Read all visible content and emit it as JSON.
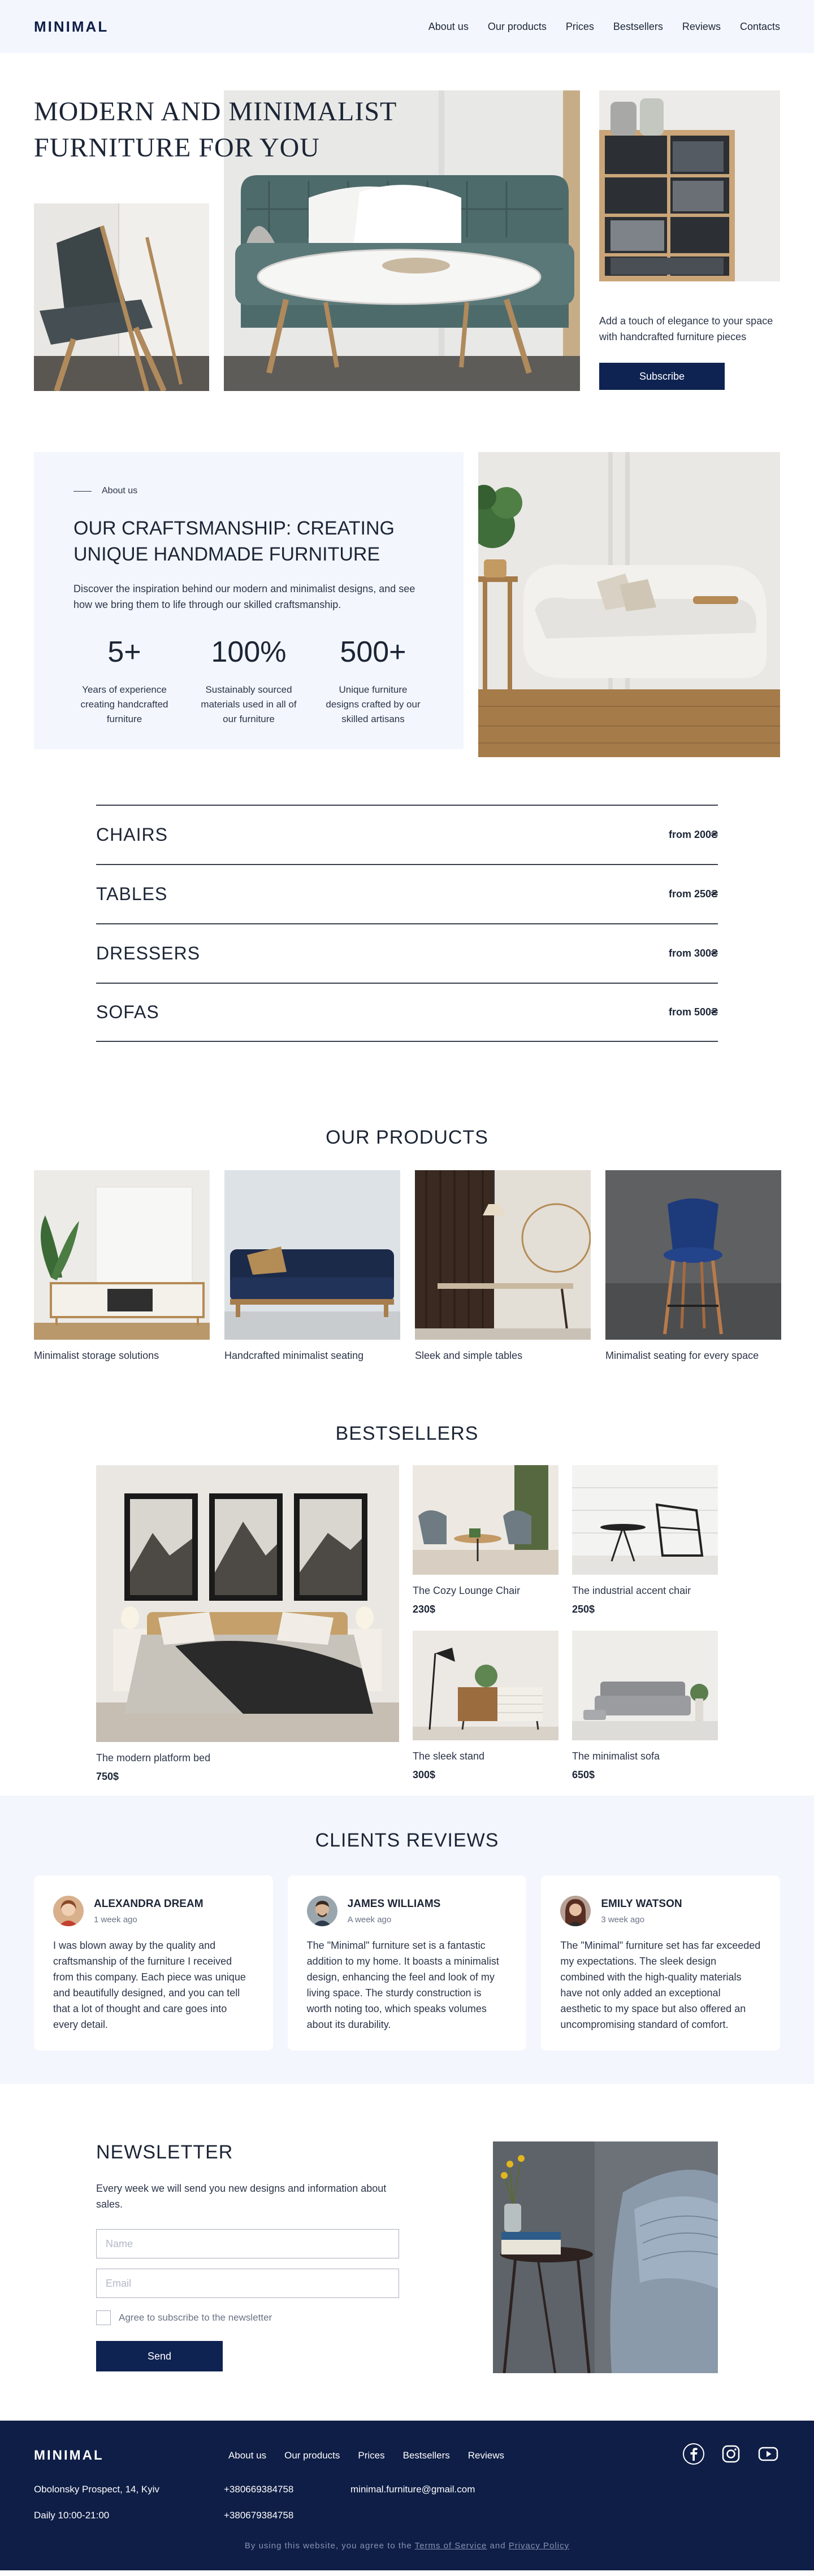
{
  "header": {
    "logo": "MINIMAL",
    "nav": [
      "About us",
      "Our products",
      "Prices",
      "Bestsellers",
      "Reviews",
      "Contacts"
    ]
  },
  "hero": {
    "title_line1": "MODERN AND MINIMALIST",
    "title_line2": "FURNITURE FOR YOU",
    "text": "Add a touch of elegance to your space with handcrafted furniture pieces",
    "button": "Subscribe"
  },
  "about": {
    "kicker": "About us",
    "title": "OUR CRAFTSMANSHIP: CREATING UNIQUE HANDMADE FURNITURE",
    "description": "Discover the inspiration behind our modern and minimalist designs, and see how we bring them to life through our skilled craftsmanship.",
    "stats": [
      {
        "value": "5+",
        "label": "Years of experience creating handcrafted furniture"
      },
      {
        "value": "100%",
        "label": "Sustainably sourced materials used in all of our furniture"
      },
      {
        "value": "500+",
        "label": "Unique furniture designs crafted by our skilled artisans"
      }
    ]
  },
  "categories": [
    {
      "name": "CHAIRS",
      "price": "from 200₴"
    },
    {
      "name": "TABLES",
      "price": "from 250₴"
    },
    {
      "name": "DRESSERS",
      "price": "from 300₴"
    },
    {
      "name": "SOFAS",
      "price": "from 500₴"
    }
  ],
  "products": {
    "title": "OUR PRODUCTS",
    "items": [
      "Minimalist storage solutions",
      "Handcrafted minimalist seating",
      "Sleek and simple tables",
      "Minimalist seating for every space"
    ]
  },
  "bestsellers": {
    "title": "BESTSELLERS",
    "featured": {
      "name": "The modern platform bed",
      "price": "750$"
    },
    "items": [
      {
        "name": "The Cozy Lounge Chair",
        "price": "230$"
      },
      {
        "name": "The industrial accent chair",
        "price": "250$"
      },
      {
        "name": "The sleek stand",
        "price": "300$"
      },
      {
        "name": "The minimalist sofa",
        "price": "650$"
      }
    ]
  },
  "reviews": {
    "title": "CLIENTS REVIEWS",
    "items": [
      {
        "name": "ALEXANDRA DREAM",
        "time": "1 week ago",
        "text": "I was blown away by the quality and craftsmanship of the furniture I received from this company. Each piece was unique and beautifully designed, and you can tell that a lot of thought and care goes into every detail."
      },
      {
        "name": "JAMES WILLIAMS",
        "time": "A week ago",
        "text": "The \"Minimal\" furniture set is a fantastic addition to my home. It boasts a minimalist design, enhancing the feel and look of my living space. The sturdy construction is worth noting too, which speaks volumes about its durability."
      },
      {
        "name": "EMILY WATSON",
        "time": "3 week ago",
        "text": "The \"Minimal\" furniture set has far exceeded my expectations. The sleek design combined with the high-quality materials have not only added an exceptional aesthetic to my space but also offered an uncompromising standard of comfort."
      }
    ]
  },
  "newsletter": {
    "title": "NEWSLETTER",
    "description": "Every week we will send you new designs and information about sales.",
    "name_placeholder": "Name",
    "email_placeholder": "Email",
    "checkbox_label": "Agree to subscribe to the newsletter",
    "button": "Send"
  },
  "footer": {
    "logo": "MINIMAL",
    "nav": [
      "About us",
      "Our products",
      "Prices",
      "Bestsellers",
      "Reviews"
    ],
    "social": [
      "facebook-icon",
      "instagram-icon",
      "youtube-icon"
    ],
    "address": "Obolonsky Prospect, 14, Kyiv",
    "hours": "Daily 10:00-21:00",
    "phone1": "+380669384758",
    "phone2": "+380679384758",
    "email": "minimal.furniture@gmail.com",
    "copy_prefix": "By using this website, you agree to the",
    "terms": "Terms of Service",
    "and": "and",
    "privacy": "Privacy Policy"
  },
  "colors": {
    "primary": "#0f2352",
    "light_bg": "#f3f6fc",
    "footer_bg": "#0f1e46",
    "text": "#1c2536"
  }
}
